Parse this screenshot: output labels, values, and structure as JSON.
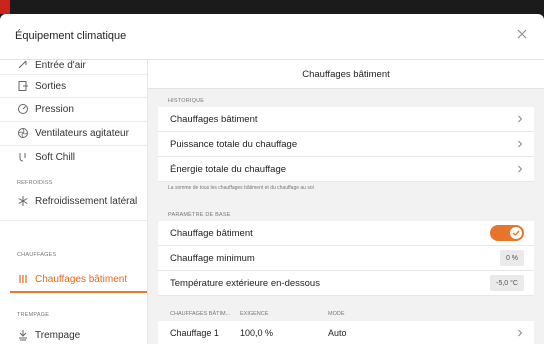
{
  "dialog": {
    "title": "Équipement climatique"
  },
  "sidebar": {
    "items": [
      {
        "label": "Entrée d'air",
        "icon": "air-inlet-icon"
      },
      {
        "label": "Sorties",
        "icon": "outlet-icon"
      },
      {
        "label": "Pression",
        "icon": "pressure-icon"
      },
      {
        "label": "Ventilateurs agitateur",
        "icon": "fan-icon"
      },
      {
        "label": "Soft Chill",
        "icon": "soft-chill-icon"
      }
    ],
    "sections": [
      {
        "title": "REFROIDISS",
        "items": [
          {
            "label": "Refroidissement latéral",
            "icon": "cooling-icon"
          }
        ]
      },
      {
        "title": "CHAUFFAGES",
        "items": [
          {
            "label": "Chauffages bâtiment",
            "icon": "heater-icon",
            "active": true
          }
        ]
      },
      {
        "title": "TREMPAGE",
        "items": [
          {
            "label": "Trempage",
            "icon": "soaking-icon"
          }
        ]
      }
    ]
  },
  "main": {
    "title": "Chauffages bâtiment",
    "historique": {
      "section": "HISTORIQUE",
      "rows": [
        "Chauffages bâtiment",
        "Puissance totale du chauffage",
        "Énergie totale du chauffage"
      ],
      "note": "La somme de tous les chauffages bâtiment et du chauffage au sol"
    },
    "parametre": {
      "section": "PARAMÈTRE DE BASE",
      "toggle_label": "Chauffage bâtiment",
      "toggle_on": true,
      "min_label": "Chauffage minimum",
      "min_value": "0 %",
      "temp_label": "Température extérieure en-dessous",
      "temp_value": "-5,0 °C"
    },
    "table": {
      "headers": [
        "CHAUFFAGES BÂTIM...",
        "EXIGENCE",
        "MODE"
      ],
      "rows": [
        {
          "name": "Chauffage 1",
          "exigence": "100,0 %",
          "mode": "Auto"
        }
      ]
    },
    "accent_color": "#e8732a"
  }
}
